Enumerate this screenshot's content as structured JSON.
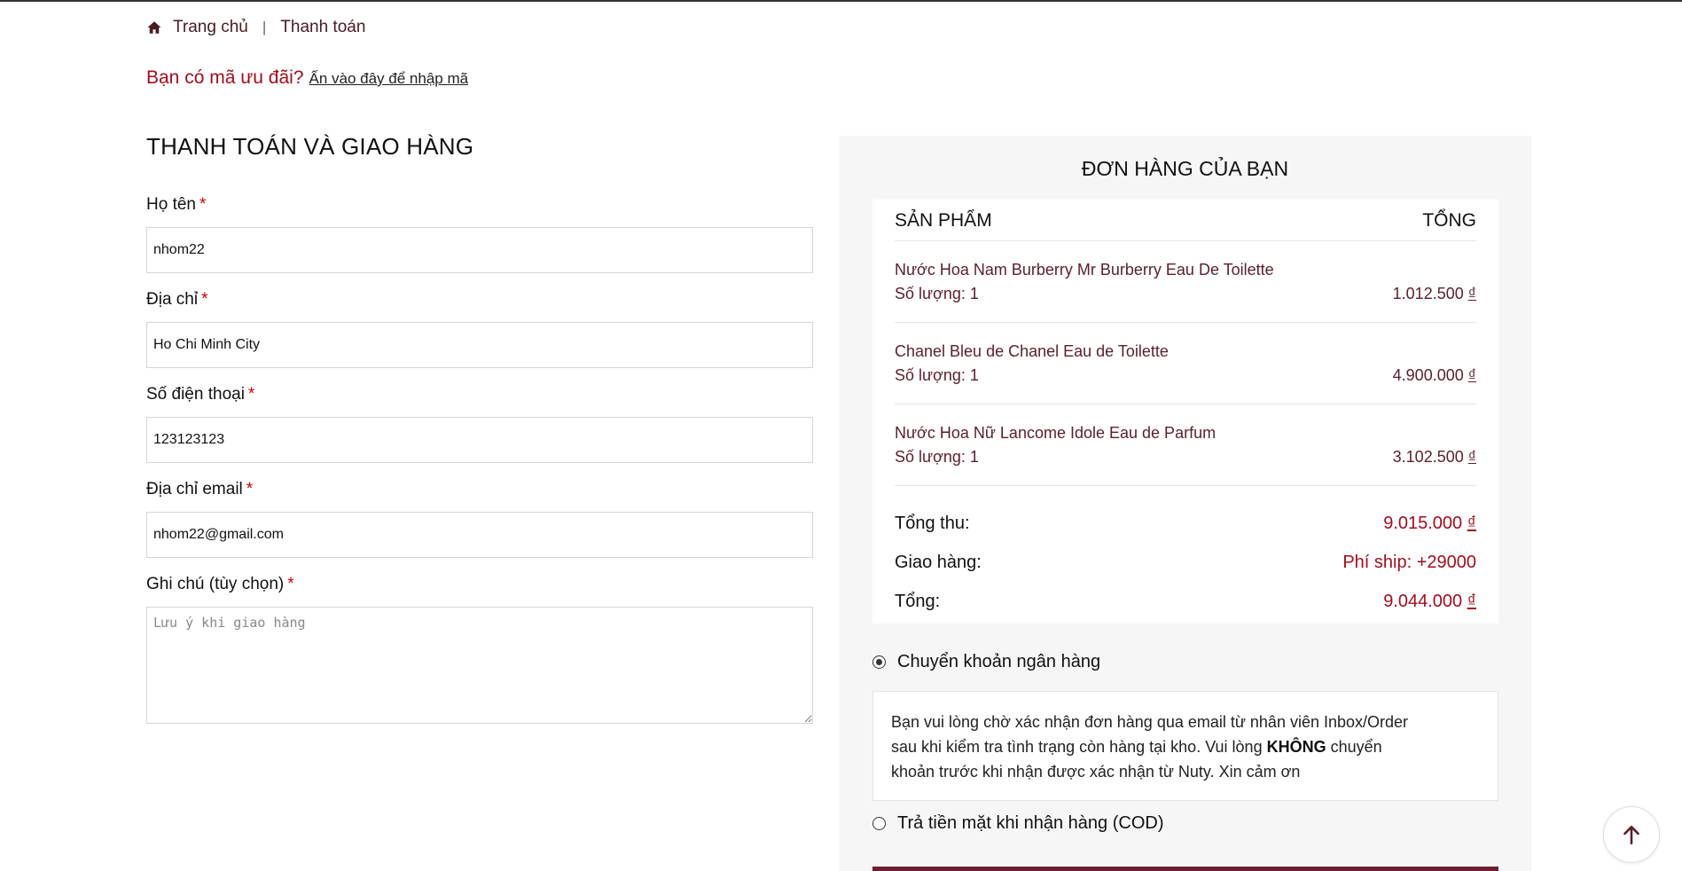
{
  "breadcrumb": {
    "home": "Trang chủ",
    "separator": "|",
    "current": "Thanh toán"
  },
  "coupon": {
    "question": "Bạn có mã ưu đãi?",
    "link": "Ấn vào đây để nhập mã"
  },
  "billing": {
    "title": "THANH TOÁN VÀ GIAO HÀNG",
    "required_mark": "*",
    "fields": {
      "name": {
        "label": "Họ tên",
        "value": "nhom22"
      },
      "address": {
        "label": "Địa chỉ",
        "value": "Ho Chi Minh City"
      },
      "phone": {
        "label": "Số điện thoại",
        "value": "123123123"
      },
      "email": {
        "label": "Địa chỉ email",
        "value": "nhom22@gmail.com"
      },
      "note": {
        "label": "Ghi chú (tùy chọn)",
        "value": "",
        "placeholder": "Lưu ý khi giao hàng"
      }
    }
  },
  "order": {
    "title": "ĐƠN HÀNG CỦA BẠN",
    "col_product": "SẢN PHẨM",
    "col_total": "TỔNG",
    "items": [
      {
        "name": "Nước Hoa Nam Burberry Mr Burberry Eau De Toilette",
        "qty": "Số lượng: 1",
        "price": "1.012.500",
        "currency": "₫"
      },
      {
        "name": "Chanel Bleu de Chanel Eau de Toilette",
        "qty": "Số lượng: 1",
        "price": "4.900.000",
        "currency": "₫"
      },
      {
        "name": "Nước Hoa Nữ Lancome Idole Eau de Parfum",
        "qty": "Số lượng: 1",
        "price": "3.102.500",
        "currency": "₫"
      }
    ],
    "subtotal": {
      "label": "Tổng thu:",
      "value": "9.015.000",
      "currency": "₫"
    },
    "shipping": {
      "label": "Giao hàng:",
      "value": "Phí ship: +29000"
    },
    "total": {
      "label": "Tổng:",
      "value": "9.044.000",
      "currency": "₫"
    }
  },
  "payment": {
    "bank_transfer": {
      "label": "Chuyển khoản ngân hàng",
      "selected": true,
      "desc_before": "Bạn vui lòng chờ xác nhận đơn hàng qua email từ nhân viên Inbox/Order sau khi kiểm tra tình trạng còn hàng tại kho. Vui lòng ",
      "desc_bold": "KHÔNG",
      "desc_after": " chuyển khoản trước khi nhận được xác nhận từ Nuty. Xin cảm ơn"
    },
    "cod": {
      "label": "Trả tiền mặt khi nhận hàng (COD)",
      "selected": false
    }
  },
  "colors": {
    "accent": "#a30d1d",
    "brand_dark": "#5b1f2b",
    "panel_bg": "#f6f6f6"
  },
  "icons": {
    "home": "home-icon",
    "scroll_top": "arrow-up-icon"
  }
}
